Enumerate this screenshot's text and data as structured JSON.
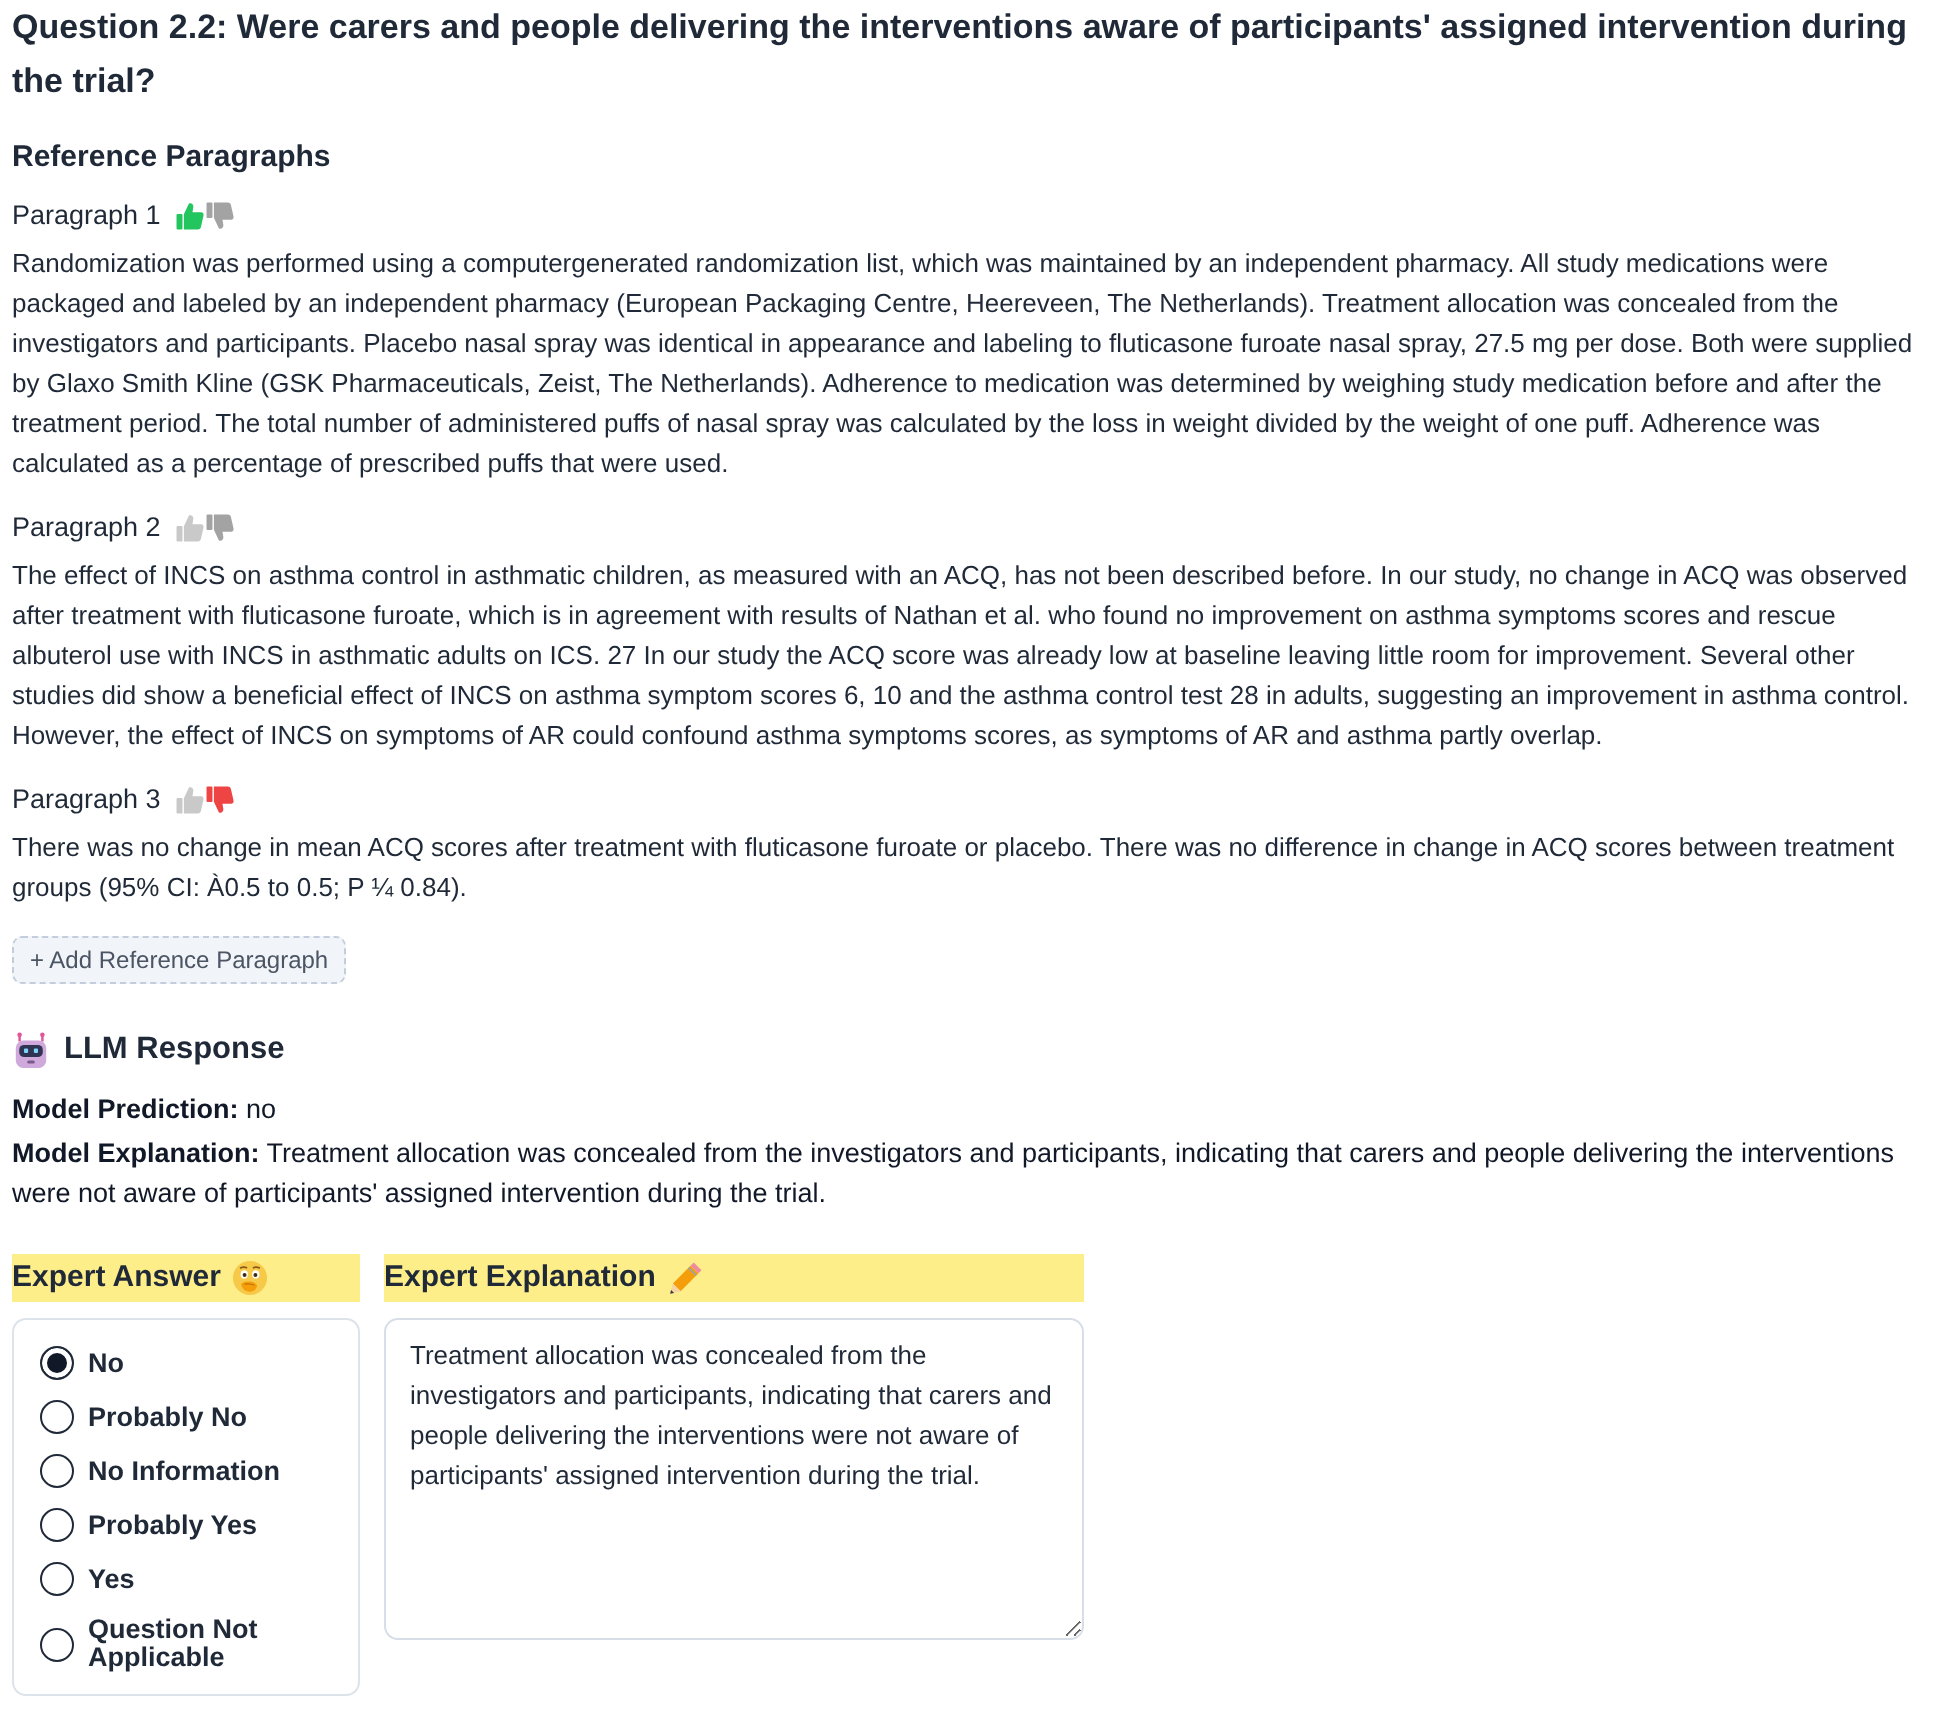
{
  "question": {
    "title": "Question 2.2: Were carers and people delivering the interventions aware of participants' assigned intervention during the trial?"
  },
  "reference_paragraphs": {
    "heading": "Reference Paragraphs",
    "paragraphs": [
      {
        "label": "Paragraph 1",
        "thumbs_up": true,
        "thumbs_down": false,
        "text": "Randomization was performed using a computergenerated randomization list, which was maintained by an independent pharmacy. All study medications were packaged and labeled by an independent pharmacy (European Packaging Centre, Heereveen, The Netherlands). Treatment allocation was concealed from the investigators and participants. Placebo nasal spray was identical in appearance and labeling to fluticasone furoate nasal spray, 27.5 mg per dose. Both were supplied by Glaxo Smith Kline (GSK Pharmaceuticals, Zeist, The Netherlands). Adherence to medication was determined by weighing study medication before and after the treatment period. The total number of administered puffs of nasal spray was calculated by the loss in weight divided by the weight of one puff. Adherence was calculated as a percentage of prescribed puffs that were used."
      },
      {
        "label": "Paragraph 2",
        "thumbs_up": false,
        "thumbs_down": false,
        "text": "The effect of INCS on asthma control in asthmatic children, as measured with an ACQ, has not been described before. In our study, no change in ACQ was observed after treatment with fluticasone furoate, which is in agreement with results of Nathan et al. who found no improvement on asthma symptoms scores and rescue albuterol use with INCS in asthmatic adults on ICS. 27 In our study the ACQ score was already low at baseline leaving little room for improvement. Several other studies did show a beneficial effect of INCS on asthma symptom scores 6, 10 and the asthma control test 28 in adults, suggesting an improvement in asthma control. However, the effect of INCS on symptoms of AR could confound asthma symptoms scores, as symptoms of AR and asthma partly overlap."
      },
      {
        "label": "Paragraph 3",
        "thumbs_up": false,
        "thumbs_down": true,
        "text": "There was no change in mean ACQ scores after treatment with fluticasone furoate or placebo. There was no difference in change in ACQ scores between treatment groups (95% CI: À0.5 to 0.5; P ¼ 0.84)."
      }
    ],
    "add_button": "+ Add Reference Paragraph"
  },
  "llm_response": {
    "heading": "LLM Response",
    "prediction": "**Model Prediction:** no",
    "explanation": "**Model Explanation:** Treatment allocation was concealed from the investigators and participants, indicating that carers and people delivering the interventions were not aware of participants' assigned intervention during the trial."
  },
  "expert_answer": {
    "heading": "Expert Answer",
    "options": [
      {
        "label": "No",
        "selected": true
      },
      {
        "label": "Probably No",
        "selected": false
      },
      {
        "label": "No Information",
        "selected": false
      },
      {
        "label": "Probably Yes",
        "selected": false
      },
      {
        "label": "Yes",
        "selected": false
      },
      {
        "label": "Question Not Applicable",
        "selected": false
      }
    ]
  },
  "expert_explanation": {
    "heading": "Expert Explanation",
    "value": "Treatment allocation was concealed from the investigators and participants, indicating that carers and people delivering the interventions were not aware of participants' assigned intervention during the trial."
  }
}
